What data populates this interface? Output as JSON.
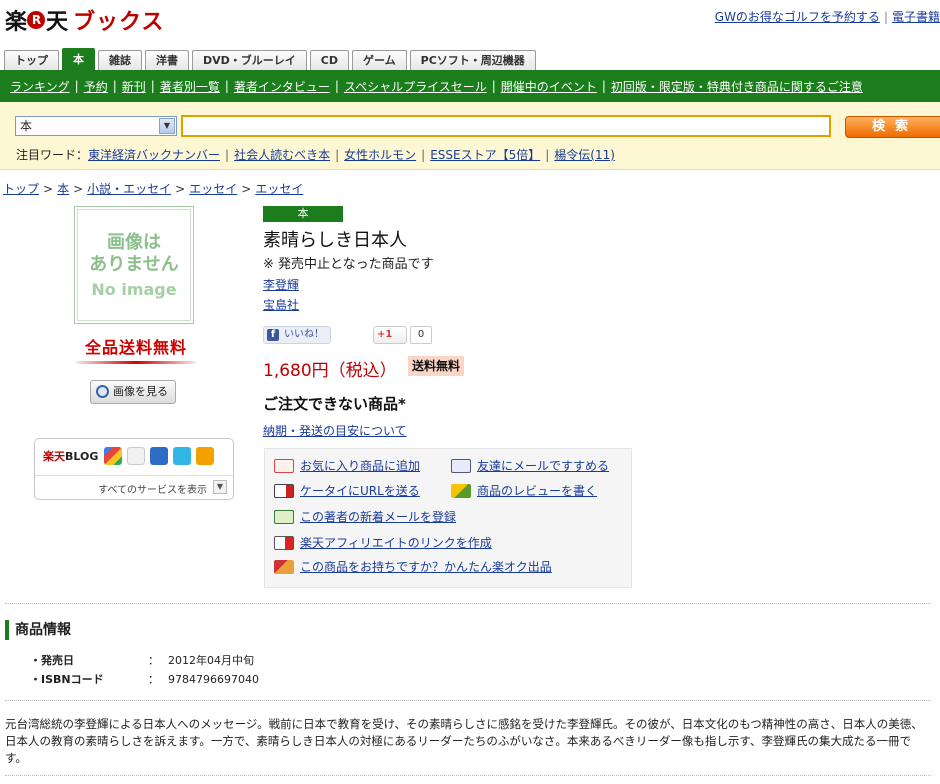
{
  "header": {
    "logo_part1": "楽",
    "logo_r": "R",
    "logo_part2": "天",
    "logo_books": "ブックス",
    "links": [
      "GWのお得なゴルフを予約する",
      "電子書籍"
    ]
  },
  "tabs": [
    "トップ",
    "本",
    "雑誌",
    "洋書",
    "DVD・ブルーレイ",
    "CD",
    "ゲーム",
    "PCソフト・周辺機器"
  ],
  "catnav": [
    "ランキング",
    "予約",
    "新刊",
    "著者別一覧",
    "著者インタビュー",
    "スペシャルプライスセール",
    "開催中のイベント",
    "初回版・限定版・特典付き商品に関するご注意"
  ],
  "search": {
    "category_value": "本",
    "input_value": "",
    "button_label": "検索",
    "hotwords_label": "注目ワード：",
    "hotwords": [
      "東洋経済バックナンバー",
      "社会人読むべき本",
      "女性ホルモン",
      "ESSEストア【5倍】",
      "楊令伝(11)"
    ]
  },
  "breadcrumb": [
    "トップ",
    "本",
    "小説・エッセイ",
    "エッセイ",
    "エッセイ"
  ],
  "left": {
    "noimage_ja_line1": "画像は",
    "noimage_ja_line2": "ありません",
    "noimage_en": "No image",
    "freeship_badge": "全品送料無料",
    "view_image_button": "画像を見る",
    "blog_label_red": "楽天",
    "blog_label": "BLOG",
    "all_services": "すべてのサービスを表示"
  },
  "product": {
    "type_badge": "本",
    "title": "素晴らしき日本人",
    "discontinued_note": "※ 発売中止となった商品です",
    "author": "李登輝",
    "publisher": "宝島社",
    "fb_like": "いいね！",
    "gplus": "+1",
    "gplus_count": "0",
    "price": "1,680円（税込）",
    "freeship_tag": "送料無料",
    "unorderable": "ご注文できない商品*",
    "delivery_link": "納期・発送の目安について"
  },
  "actions": {
    "favorite": "お気に入り商品に追加",
    "mail_friend": "友達にメールですすめる",
    "mobile_url": "ケータイにURLを送る",
    "review": "商品のレビューを書く",
    "author_mail": "この著者の新着メールを登録",
    "affiliate": "楽天アフィリエイトのリンクを作成",
    "auction": "この商品をお持ちですか？かんたん楽オク出品"
  },
  "info": {
    "heading": "商品情報",
    "rows": [
      {
        "key": "・発売日",
        "colon": "：",
        "value": "2012年04月中旬"
      },
      {
        "key": "・ISBNコード",
        "colon": "：",
        "value": "9784796697040"
      }
    ],
    "description": "元台湾総統の李登輝による日本人へのメッセージ。戦前に日本で教育を受け、その素晴らしさに感銘を受けた李登輝氏。その彼が、日本文化のもつ精神性の高さ、日本人の美徳、日本人の教育の素晴らしさを訴えます。一方で、素晴らしき日本人の対極にあるリーダーたちのふがいなさ。本来あるべきリーダー像も指し示す、李登輝氏の集大成たる一冊です。"
  },
  "colors": {
    "green": "#1b7d1b",
    "red": "#bf0000",
    "link": "#1a3c99",
    "search_bg": "#fdf8d3",
    "search_button": "#ee6a00"
  }
}
